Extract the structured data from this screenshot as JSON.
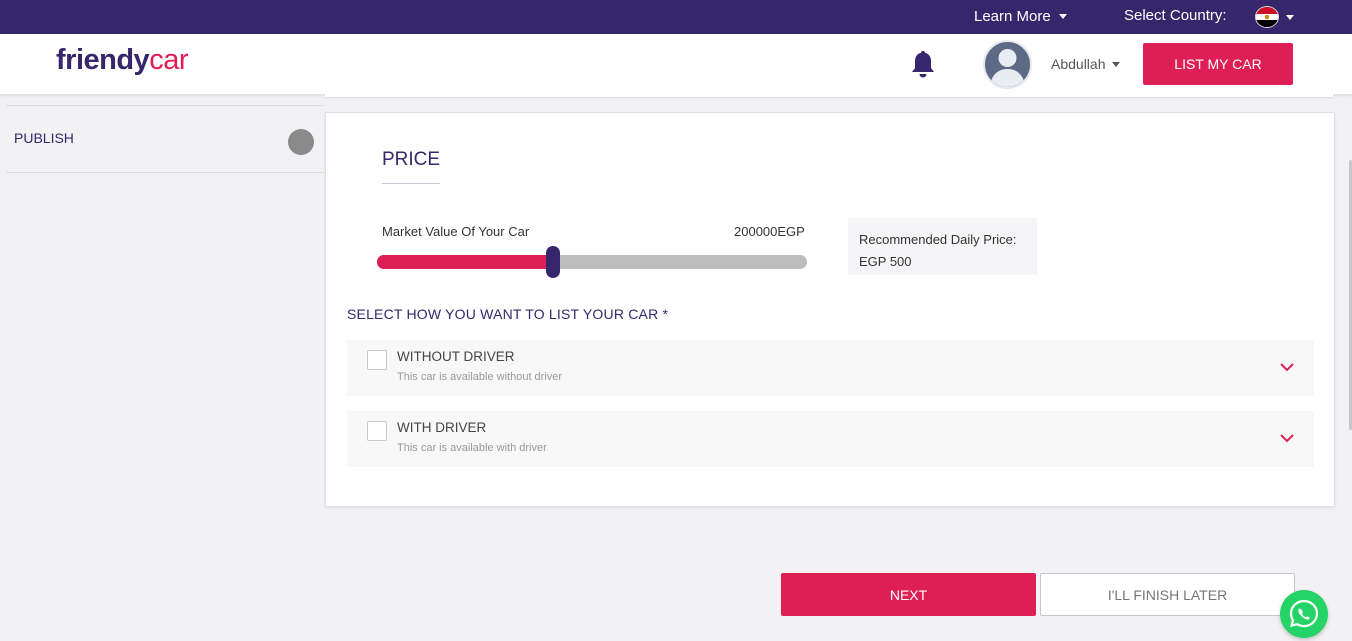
{
  "topbar": {
    "learn_more": "Learn More",
    "select_country": "Select Country:",
    "country_flag": "egypt-flag"
  },
  "header": {
    "logo_part1": "friendy",
    "logo_part2": "car",
    "username": "Abdullah",
    "list_button": "LIST MY CAR"
  },
  "sidebar": {
    "step_label": "PUBLISH"
  },
  "price": {
    "title": "PRICE",
    "market_value_label": "Market Value Of Your Car",
    "market_value": "200000EGP",
    "slider_fraction": 0.41,
    "recommended_label": "Recommended Daily Price:",
    "recommended_value": "EGP 500"
  },
  "listing": {
    "title": "SELECT HOW YOU WANT TO LIST YOUR CAR *",
    "options": [
      {
        "title": "WITHOUT DRIVER",
        "subtitle": "This car is available without driver",
        "checked": false
      },
      {
        "title": "WITH DRIVER",
        "subtitle": "This car is available with driver",
        "checked": false
      }
    ]
  },
  "footer": {
    "next": "NEXT",
    "finish_later": "I'LL FINISH LATER"
  },
  "colors": {
    "brand_purple": "#36276d",
    "brand_pink": "#de1f55",
    "whatsapp": "#25d366"
  }
}
